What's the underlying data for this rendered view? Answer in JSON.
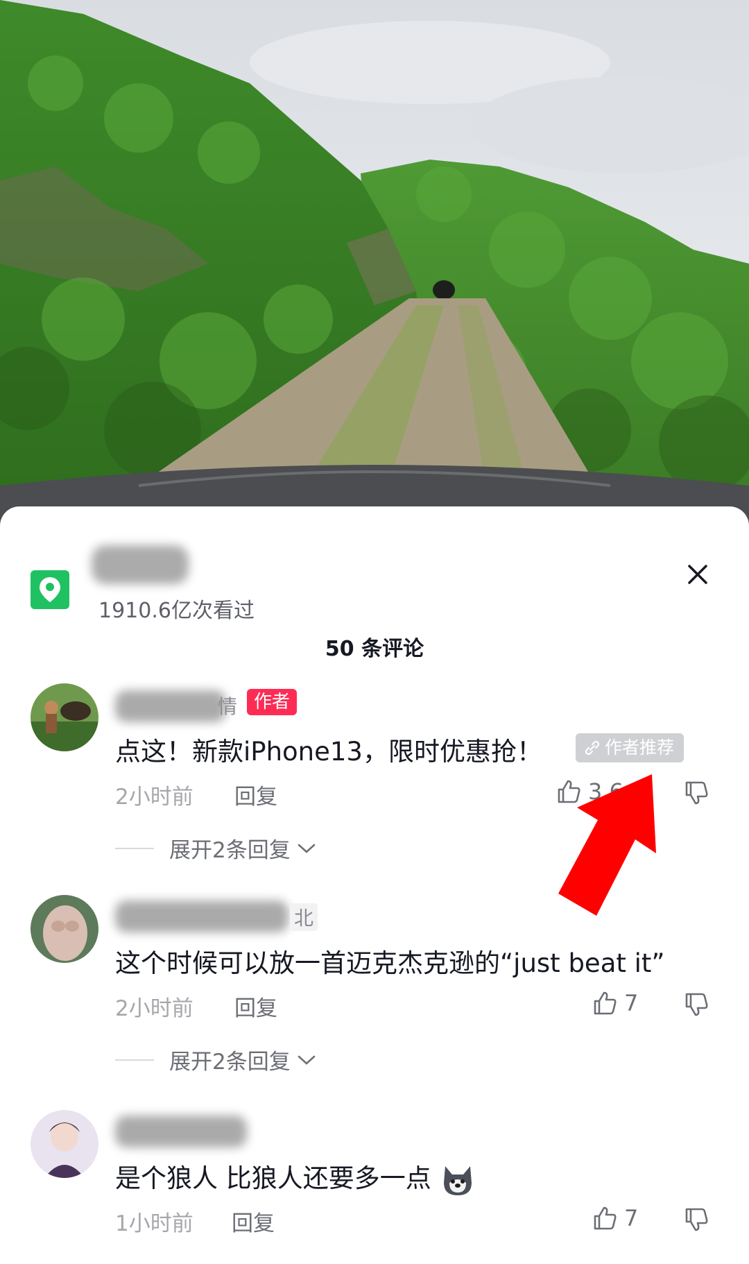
{
  "location": {
    "icon": "location-pin-icon",
    "views": "1910.6亿次看过",
    "accent_color": "#20c162"
  },
  "close_icon": "close-icon",
  "comments_header": "50 条评论",
  "comments": [
    {
      "name_tail": "情",
      "author_badge": "作者",
      "text": "点这！新款iPhone13，限时优惠抢！",
      "tag": "作者推荐",
      "time": "2小时前",
      "reply": "回复",
      "likes": "3.6",
      "expand": "展开2条回复"
    },
    {
      "name_tail": "北",
      "text": "这个时候可以放一首迈克杰克逊的“just beat it”",
      "time": "2小时前",
      "reply": "回复",
      "likes": "7",
      "expand": "展开2条回复"
    },
    {
      "text": "是个狼人  比狼人还要多一点",
      "time": "1小时前",
      "reply": "回复",
      "likes": "7"
    }
  ],
  "colors": {
    "badge": "#fe2c55",
    "arrow": "#ff0000",
    "text_primary": "#161823",
    "text_secondary": "#6c6e75"
  }
}
